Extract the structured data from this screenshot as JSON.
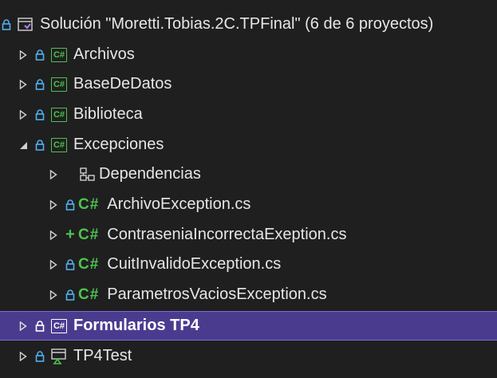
{
  "solution": {
    "label": "Solución \"Moretti.Tobias.2C.TPFinal\" (6 de 6 proyectos)"
  },
  "projects": [
    {
      "label": "Archivos",
      "expanded": false
    },
    {
      "label": "BaseDeDatos",
      "expanded": false
    },
    {
      "label": "Biblioteca",
      "expanded": false
    },
    {
      "label": "Excepciones",
      "expanded": true
    },
    {
      "label": "Formularios TP4",
      "expanded": false,
      "selected": true
    },
    {
      "label": "TP4Test",
      "expanded": false
    }
  ],
  "excepciones_children": {
    "dependencies_label": "Dependencias",
    "files": [
      {
        "label": "ArchivoException.cs",
        "status": "lock"
      },
      {
        "label": "ContraseniaIncorrectaExeption.cs",
        "status": "added"
      },
      {
        "label": "CuitInvalidoException.cs",
        "status": "lock"
      },
      {
        "label": "ParametrosVaciosException.cs",
        "status": "lock"
      }
    ]
  },
  "colors": {
    "background": "#1f1f1f",
    "selection": "#4b3b8f",
    "lock": "#4fb0f0",
    "csharp": "#4ec24e",
    "text": "#e6e6e6"
  },
  "icons": {
    "cs_glyph": "C#",
    "csproj_glyph": "C#",
    "lock_glyph": "🔒",
    "plus_glyph": "+"
  }
}
